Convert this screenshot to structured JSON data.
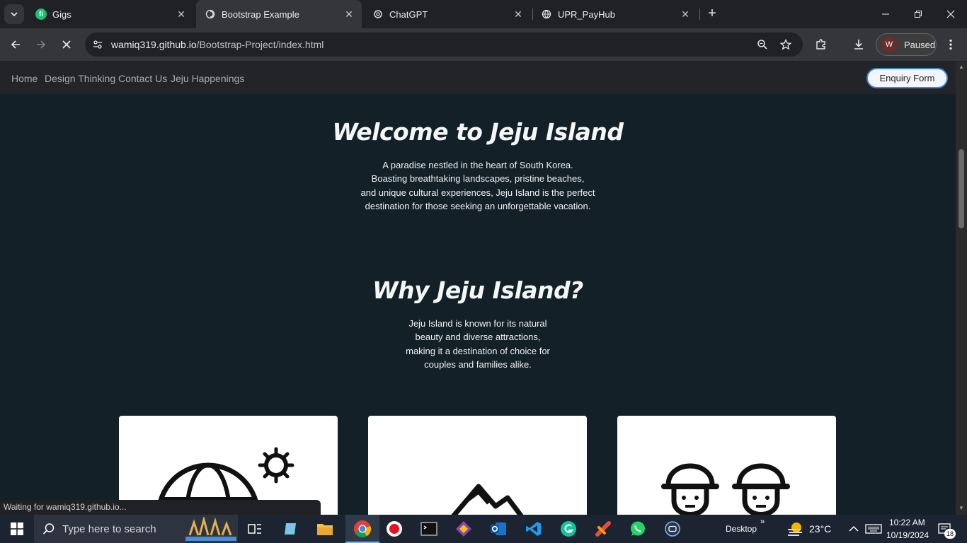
{
  "browser": {
    "tabs": [
      {
        "title": "Gigs",
        "favicon": "fiverr-icon",
        "active": false
      },
      {
        "title": "Bootstrap Example",
        "favicon": "globe-icon",
        "active": true
      },
      {
        "title": "ChatGPT",
        "favicon": "openai-icon",
        "active": false
      },
      {
        "title": "UPR_PayHub",
        "favicon": "globe-icon",
        "active": false
      }
    ],
    "url_host": "wamiq319.github.io",
    "url_path": "/Bootstrap-Project/index.html",
    "profile_initial": "W",
    "profile_label": "Paused",
    "status_text": "Waiting for wamiq319.github.io..."
  },
  "site": {
    "nav": [
      "Home",
      "Design Thinking",
      "Contact Us",
      "Jeju Happenings"
    ],
    "enquiry_label": "Enquiry Form",
    "hero": {
      "title": "Welcome to Jeju Island",
      "lines": [
        "A paradise nestled in the heart of South Korea.",
        "Boasting breathtaking landscapes, pristine beaches,",
        "and unique cultural experiences, Jeju Island is the perfect",
        "destination for those seeking an unforgettable vacation."
      ]
    },
    "why": {
      "title": "Why Jeju Island?",
      "lines": [
        "Jeju Island is known for its natural",
        "beauty and diverse attractions,",
        "making it a destination of choice for",
        "couples and families alike."
      ]
    },
    "cards": [
      {
        "icon": "globe-sun-icon"
      },
      {
        "icon": "mountain-icon"
      },
      {
        "icon": "couple-icon"
      }
    ]
  },
  "taskbar": {
    "search_placeholder": "Type here to search",
    "desktop_label": "Desktop",
    "temperature": "23°C",
    "time": "10:22 AM",
    "date": "10/19/2024",
    "notification_count": "18"
  },
  "colors": {
    "page_bg": "#132028",
    "navbar_bg": "#222428",
    "accent": "#3f86d8"
  }
}
